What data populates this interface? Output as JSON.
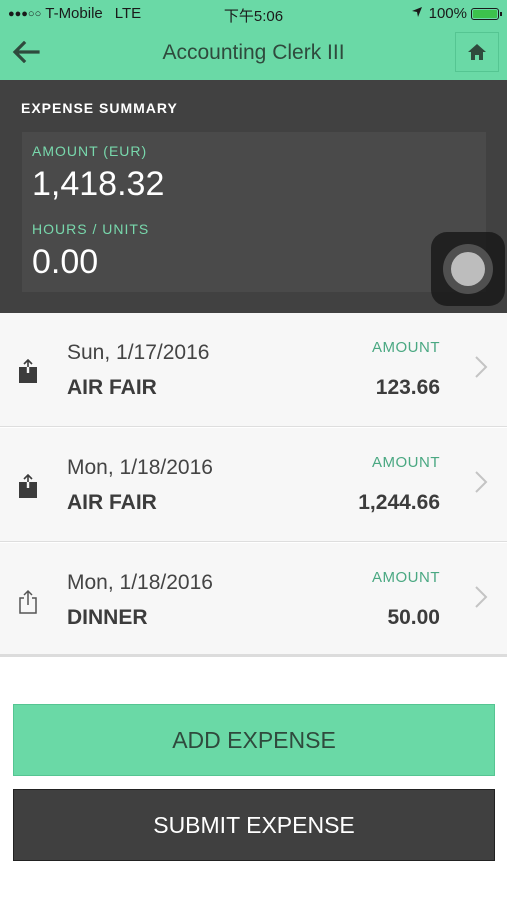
{
  "status_bar": {
    "signal": "●●●○○",
    "carrier": "T-Mobile",
    "network": "LTE",
    "time": "下午5:06",
    "battery_percent": "100%",
    "battery_level": 1.0
  },
  "nav": {
    "title": "Accounting Clerk III",
    "back_icon": "arrow-left-icon",
    "home_icon": "home-icon"
  },
  "summary": {
    "title": "EXPENSE SUMMARY",
    "amount_label": "AMOUNT (EUR)",
    "amount_value": "1,418.32",
    "hours_label": "HOURS / UNITS",
    "hours_value": "0.00"
  },
  "expenses": [
    {
      "date": "Sun, 1/17/2016",
      "category": "AIR FAIR",
      "amount_label": "AMOUNT",
      "amount": "123.66",
      "icon": "share-filled-icon"
    },
    {
      "date": "Mon, 1/18/2016",
      "category": "AIR FAIR",
      "amount_label": "AMOUNT",
      "amount": "1,244.66",
      "icon": "share-filled-icon"
    },
    {
      "date": "Mon, 1/18/2016",
      "category": "DINNER",
      "amount_label": "AMOUNT",
      "amount": "50.00",
      "icon": "share-outline-icon"
    }
  ],
  "actions": {
    "add_label": "ADD EXPENSE",
    "submit_label": "SUBMIT EXPENSE"
  },
  "colors": {
    "accent_green": "#6ad9a6",
    "summary_bg": "#414141",
    "label_green": "#78d8ac"
  }
}
